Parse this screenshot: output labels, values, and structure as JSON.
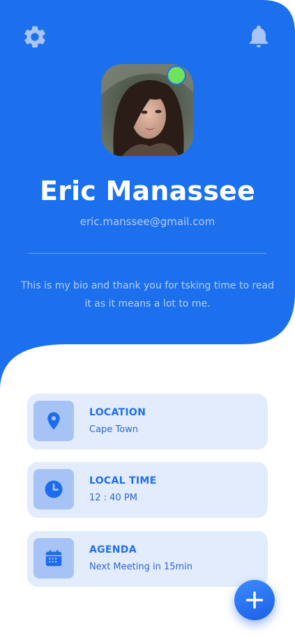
{
  "profile": {
    "name": "Eric Manassee",
    "email": "eric.manssee@gmail.com",
    "bio": "This is my bio and thank you for tsking time to read it as it means a lot to me.",
    "online": true
  },
  "header": {
    "settings_icon": "gear-icon",
    "notifications_icon": "bell-icon"
  },
  "cards": [
    {
      "title": "LOCATION",
      "value": "Cape Town",
      "icon": "location-pin-icon"
    },
    {
      "title": "LOCAL TIME",
      "value": "12 : 40  PM",
      "icon": "clock-icon"
    },
    {
      "title": "AGENDA",
      "value": "Next Meeting in 15min",
      "icon": "calendar-icon"
    }
  ],
  "fab": {
    "icon": "plus-icon"
  },
  "colors": {
    "primary": "#1c70ee",
    "card_bg": "#e3ecfd",
    "icon_tile": "#a7c3f5",
    "online": "#6fe35c"
  }
}
